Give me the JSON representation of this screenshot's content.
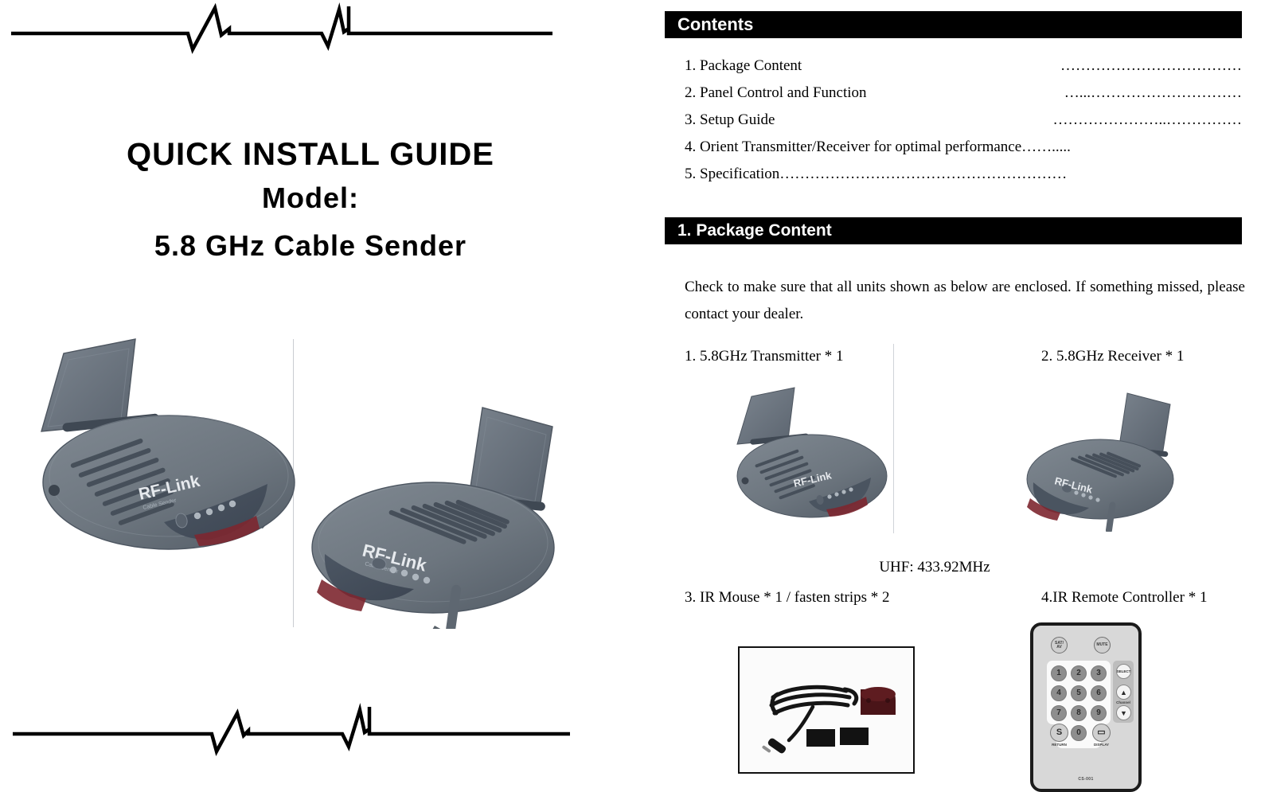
{
  "cover": {
    "title_line1": "QUICK INSTALL GUIDE",
    "title_line2": "Model:",
    "title_line3": "5.8 GHz Cable Sender",
    "device_brand": "RF-Link",
    "device_subbrand": "Cable Sender"
  },
  "contents": {
    "header": "Contents",
    "items": [
      {
        "label": "1. Package Content",
        "dots": "………………………………"
      },
      {
        "label": "2. Panel Control and Function",
        "dots": "…...…………………………"
      },
      {
        "label": "3. Setup Guide",
        "dots": "…………………..……………"
      },
      {
        "label": "4. Orient Transmitter/Receiver for optimal performance",
        "dots": "……....."
      },
      {
        "label": "5. Specification",
        "dots": "…………………………………………………"
      }
    ]
  },
  "package": {
    "header": "1. Package Content",
    "intro": "Check to make sure that all units shown as below are enclosed. If something missed, please contact your dealer.",
    "item1_label": "1. 5.8GHz Transmitter * 1",
    "item2_label": "2. 5.8GHz Receiver * 1",
    "uhf_note": "UHF: 433.92MHz",
    "item3_label": "3. IR Mouse * 1 / fasten strips * 2",
    "item4_label": "4.IR Remote Controller * 1"
  },
  "remote": {
    "btn_satav_line1": "SAT/",
    "btn_satav_line2": "AV",
    "btn_mute": "MUTE",
    "keys": [
      "1",
      "2",
      "3",
      "4",
      "5",
      "6",
      "7",
      "8",
      "9"
    ],
    "btn_zero": "0",
    "btn_return_icon": "S",
    "btn_return_label": "RETURN",
    "btn_display_icon": "▭",
    "btn_display_label": "DISPLAY",
    "btn_select": "SELECT",
    "btn_up": "▲",
    "btn_channel_label": "Channel",
    "btn_down": "▼",
    "model_code": "CS-001"
  },
  "colors": {
    "header_bar": "#000000",
    "header_text": "#ffffff",
    "page_background": "#ffffff",
    "device_body": "#6e7780",
    "device_body_dark": "#4a5360",
    "device_accent": "#515a66",
    "device_red": "#7d2730",
    "remote_body": "#d8d8d8",
    "remote_border": "#1b1b1b"
  }
}
